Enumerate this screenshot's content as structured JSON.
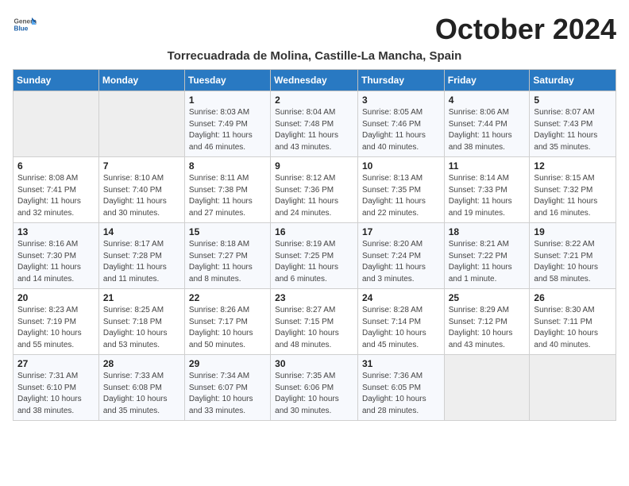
{
  "header": {
    "logo_general": "General",
    "logo_blue": "Blue",
    "month_title": "October 2024",
    "location": "Torrecuadrada de Molina, Castille-La Mancha, Spain"
  },
  "weekdays": [
    "Sunday",
    "Monday",
    "Tuesday",
    "Wednesday",
    "Thursday",
    "Friday",
    "Saturday"
  ],
  "weeks": [
    [
      {
        "day": "",
        "info": ""
      },
      {
        "day": "",
        "info": ""
      },
      {
        "day": "1",
        "info": "Sunrise: 8:03 AM\nSunset: 7:49 PM\nDaylight: 11 hours and 46 minutes."
      },
      {
        "day": "2",
        "info": "Sunrise: 8:04 AM\nSunset: 7:48 PM\nDaylight: 11 hours and 43 minutes."
      },
      {
        "day": "3",
        "info": "Sunrise: 8:05 AM\nSunset: 7:46 PM\nDaylight: 11 hours and 40 minutes."
      },
      {
        "day": "4",
        "info": "Sunrise: 8:06 AM\nSunset: 7:44 PM\nDaylight: 11 hours and 38 minutes."
      },
      {
        "day": "5",
        "info": "Sunrise: 8:07 AM\nSunset: 7:43 PM\nDaylight: 11 hours and 35 minutes."
      }
    ],
    [
      {
        "day": "6",
        "info": "Sunrise: 8:08 AM\nSunset: 7:41 PM\nDaylight: 11 hours and 32 minutes."
      },
      {
        "day": "7",
        "info": "Sunrise: 8:10 AM\nSunset: 7:40 PM\nDaylight: 11 hours and 30 minutes."
      },
      {
        "day": "8",
        "info": "Sunrise: 8:11 AM\nSunset: 7:38 PM\nDaylight: 11 hours and 27 minutes."
      },
      {
        "day": "9",
        "info": "Sunrise: 8:12 AM\nSunset: 7:36 PM\nDaylight: 11 hours and 24 minutes."
      },
      {
        "day": "10",
        "info": "Sunrise: 8:13 AM\nSunset: 7:35 PM\nDaylight: 11 hours and 22 minutes."
      },
      {
        "day": "11",
        "info": "Sunrise: 8:14 AM\nSunset: 7:33 PM\nDaylight: 11 hours and 19 minutes."
      },
      {
        "day": "12",
        "info": "Sunrise: 8:15 AM\nSunset: 7:32 PM\nDaylight: 11 hours and 16 minutes."
      }
    ],
    [
      {
        "day": "13",
        "info": "Sunrise: 8:16 AM\nSunset: 7:30 PM\nDaylight: 11 hours and 14 minutes."
      },
      {
        "day": "14",
        "info": "Sunrise: 8:17 AM\nSunset: 7:28 PM\nDaylight: 11 hours and 11 minutes."
      },
      {
        "day": "15",
        "info": "Sunrise: 8:18 AM\nSunset: 7:27 PM\nDaylight: 11 hours and 8 minutes."
      },
      {
        "day": "16",
        "info": "Sunrise: 8:19 AM\nSunset: 7:25 PM\nDaylight: 11 hours and 6 minutes."
      },
      {
        "day": "17",
        "info": "Sunrise: 8:20 AM\nSunset: 7:24 PM\nDaylight: 11 hours and 3 minutes."
      },
      {
        "day": "18",
        "info": "Sunrise: 8:21 AM\nSunset: 7:22 PM\nDaylight: 11 hours and 1 minute."
      },
      {
        "day": "19",
        "info": "Sunrise: 8:22 AM\nSunset: 7:21 PM\nDaylight: 10 hours and 58 minutes."
      }
    ],
    [
      {
        "day": "20",
        "info": "Sunrise: 8:23 AM\nSunset: 7:19 PM\nDaylight: 10 hours and 55 minutes."
      },
      {
        "day": "21",
        "info": "Sunrise: 8:25 AM\nSunset: 7:18 PM\nDaylight: 10 hours and 53 minutes."
      },
      {
        "day": "22",
        "info": "Sunrise: 8:26 AM\nSunset: 7:17 PM\nDaylight: 10 hours and 50 minutes."
      },
      {
        "day": "23",
        "info": "Sunrise: 8:27 AM\nSunset: 7:15 PM\nDaylight: 10 hours and 48 minutes."
      },
      {
        "day": "24",
        "info": "Sunrise: 8:28 AM\nSunset: 7:14 PM\nDaylight: 10 hours and 45 minutes."
      },
      {
        "day": "25",
        "info": "Sunrise: 8:29 AM\nSunset: 7:12 PM\nDaylight: 10 hours and 43 minutes."
      },
      {
        "day": "26",
        "info": "Sunrise: 8:30 AM\nSunset: 7:11 PM\nDaylight: 10 hours and 40 minutes."
      }
    ],
    [
      {
        "day": "27",
        "info": "Sunrise: 7:31 AM\nSunset: 6:10 PM\nDaylight: 10 hours and 38 minutes."
      },
      {
        "day": "28",
        "info": "Sunrise: 7:33 AM\nSunset: 6:08 PM\nDaylight: 10 hours and 35 minutes."
      },
      {
        "day": "29",
        "info": "Sunrise: 7:34 AM\nSunset: 6:07 PM\nDaylight: 10 hours and 33 minutes."
      },
      {
        "day": "30",
        "info": "Sunrise: 7:35 AM\nSunset: 6:06 PM\nDaylight: 10 hours and 30 minutes."
      },
      {
        "day": "31",
        "info": "Sunrise: 7:36 AM\nSunset: 6:05 PM\nDaylight: 10 hours and 28 minutes."
      },
      {
        "day": "",
        "info": ""
      },
      {
        "day": "",
        "info": ""
      }
    ]
  ]
}
